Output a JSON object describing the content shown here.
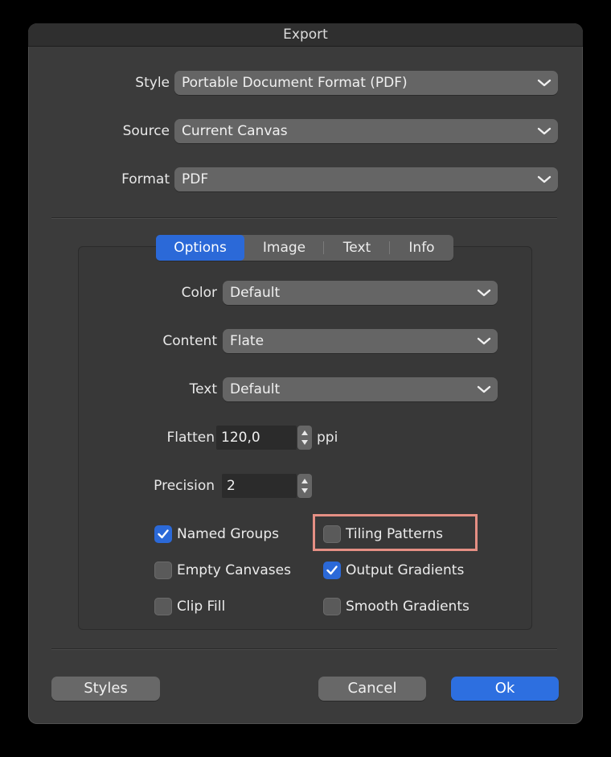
{
  "window": {
    "title": "Export"
  },
  "top": {
    "style": {
      "label": "Style",
      "value": "Portable Document Format (PDF)"
    },
    "source": {
      "label": "Source",
      "value": "Current Canvas"
    },
    "format": {
      "label": "Format",
      "value": "PDF"
    }
  },
  "tabs": {
    "options": "Options",
    "image": "Image",
    "text": "Text",
    "info": "Info",
    "active": "Options"
  },
  "options": {
    "color": {
      "label": "Color",
      "value": "Default"
    },
    "content": {
      "label": "Content",
      "value": "Flate"
    },
    "text": {
      "label": "Text",
      "value": "Default"
    },
    "flatten": {
      "label": "Flatten",
      "value": "120,0",
      "unit": "ppi"
    },
    "precision": {
      "label": "Precision",
      "value": "2"
    }
  },
  "checkboxes": {
    "named_groups": {
      "label": "Named Groups",
      "checked": true
    },
    "tiling_patterns": {
      "label": "Tiling Patterns",
      "checked": false
    },
    "empty_canvases": {
      "label": "Empty Canvases",
      "checked": false
    },
    "output_gradients": {
      "label": "Output Gradients",
      "checked": true
    },
    "clip_fill": {
      "label": "Clip Fill",
      "checked": false
    },
    "smooth_gradients": {
      "label": "Smooth Gradients",
      "checked": false
    }
  },
  "buttons": {
    "styles": "Styles",
    "cancel": "Cancel",
    "ok": "Ok"
  },
  "colors": {
    "accent": "#2b69d8",
    "highlight_box": "#e58f84"
  }
}
